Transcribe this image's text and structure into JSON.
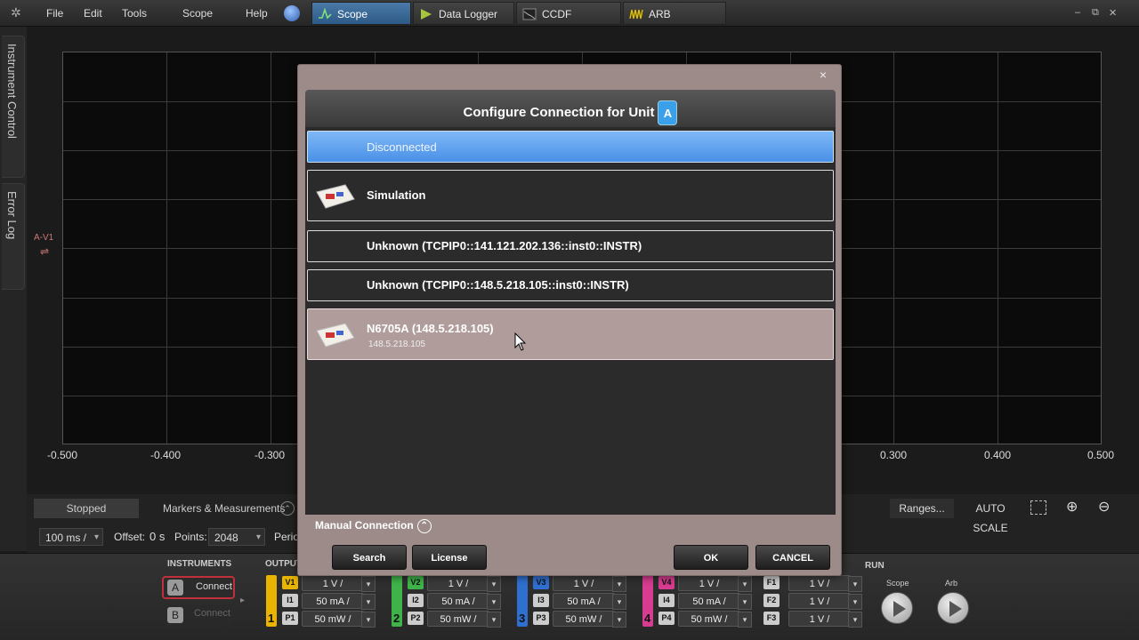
{
  "menu": [
    "File",
    "Edit",
    "Tools",
    "Scope",
    "Help"
  ],
  "tabs": [
    {
      "label": "Scope",
      "icon": "scope-wave-icon",
      "active": true
    },
    {
      "label": "Data Logger",
      "icon": "data-logger-icon",
      "active": false
    },
    {
      "label": "CCDF",
      "icon": "ccdf-icon",
      "active": false
    },
    {
      "label": "ARB",
      "icon": "arb-wave-icon",
      "active": false
    }
  ],
  "window_controls": {
    "minimize": "–",
    "restore": "⧉",
    "close": "✕"
  },
  "sidebar": {
    "instrument_control": "Instrument Control",
    "error_log": "Error Log"
  },
  "plot": {
    "x_ticks": [
      "-0.500",
      "-0.400",
      "-0.300",
      "0.300",
      "0.400",
      "0.500"
    ],
    "marker_label": "A-V1"
  },
  "status_panel": {
    "stopped": "Stopped",
    "markers": "Markers & Measurements",
    "time_div": "100 ms /",
    "offset_label": "Offset:",
    "offset_value": "0 s",
    "points_label": "Points:",
    "points_value": "2048",
    "period_label": "Perio",
    "ranges": "Ranges...",
    "auto_scale": "AUTO SCALE"
  },
  "toolbar": {
    "instruments_label": "INSTRUMENTS",
    "output_label": "OUTPUT",
    "run_label": "RUN",
    "unit_a": "A",
    "unit_b": "B",
    "connect_a": "Connect",
    "connect_b": "Connect",
    "scope_label": "Scope",
    "arb_label": "Arb",
    "channels": [
      {
        "num": "1",
        "color": "#e8b400",
        "v": "1 V /",
        "i": "50 mA /",
        "p": "50 mW /",
        "vt": "V1",
        "it": "I1",
        "pt": "P1"
      },
      {
        "num": "2",
        "color": "#3fb34a",
        "v": "1 V /",
        "i": "50 mA /",
        "p": "50 mW /",
        "vt": "V2",
        "it": "I2",
        "pt": "P2"
      },
      {
        "num": "3",
        "color": "#2f6fd0",
        "v": "1 V /",
        "i": "50 mA /",
        "p": "50 mW /",
        "vt": "V3",
        "it": "I3",
        "pt": "P3"
      },
      {
        "num": "4",
        "color": "#d63c8f",
        "v": "1 V /",
        "i": "50 mA /",
        "p": "50 mW /",
        "vt": "V4",
        "it": "I4",
        "pt": "P4"
      }
    ],
    "functions": [
      {
        "tag": "F1",
        "value": "1 V /"
      },
      {
        "tag": "F2",
        "value": "1 V /"
      },
      {
        "tag": "F3",
        "value": "1 V /"
      }
    ]
  },
  "dialog": {
    "close": "×",
    "title": "Configure Connection for Unit",
    "unit": "A",
    "items": [
      {
        "label": "Disconnected",
        "sub": ""
      },
      {
        "label": "Simulation",
        "sub": ""
      },
      {
        "label": "Unknown (TCPIP0::141.121.202.136::inst0::INSTR)",
        "sub": ""
      },
      {
        "label": "Unknown (TCPIP0::148.5.218.105::inst0::INSTR)",
        "sub": ""
      },
      {
        "label": "N6705A (148.5.218.105)",
        "sub": "148.5.218.105"
      }
    ],
    "manual_connection": "Manual Connection",
    "search": "Search",
    "license": "License",
    "ok": "OK",
    "cancel": "CANCEL"
  },
  "colors": {
    "accent": "#4a90e8",
    "selected_item": "#6aa8f0",
    "hover_item": "#b09d9b",
    "unit_badge": "#3aa0ea",
    "connect_highlight": "#c0303a"
  }
}
